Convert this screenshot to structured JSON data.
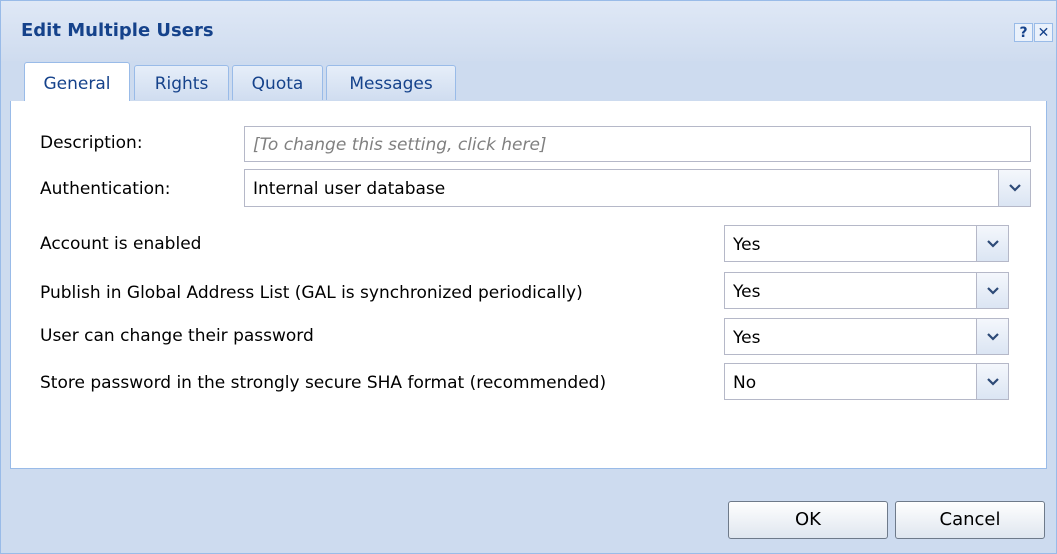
{
  "dialog": {
    "title": "Edit Multiple Users",
    "help_icon": "?",
    "close_icon": "✕"
  },
  "tabs": [
    {
      "label": "General",
      "active": true
    },
    {
      "label": "Rights",
      "active": false
    },
    {
      "label": "Quota",
      "active": false
    },
    {
      "label": "Messages",
      "active": false
    }
  ],
  "form": {
    "description_label": "Description:",
    "description_placeholder": "[To change this setting, click here]",
    "authentication_label": "Authentication:",
    "authentication_value": "Internal user database",
    "account_enabled_label": "Account is enabled",
    "account_enabled_value": "Yes",
    "publish_gal_label": "Publish in Global Address List (GAL is synchronized periodically)",
    "publish_gal_value": "Yes",
    "change_password_label": "User can change their password",
    "change_password_value": "Yes",
    "sha_label": "Store password in the strongly secure SHA format (recommended)",
    "sha_value": "No"
  },
  "buttons": {
    "ok": "OK",
    "cancel": "Cancel"
  },
  "colors": {
    "title_text": "#15428b",
    "frame_bg": "#cddbef",
    "border": "#99bbe8"
  }
}
